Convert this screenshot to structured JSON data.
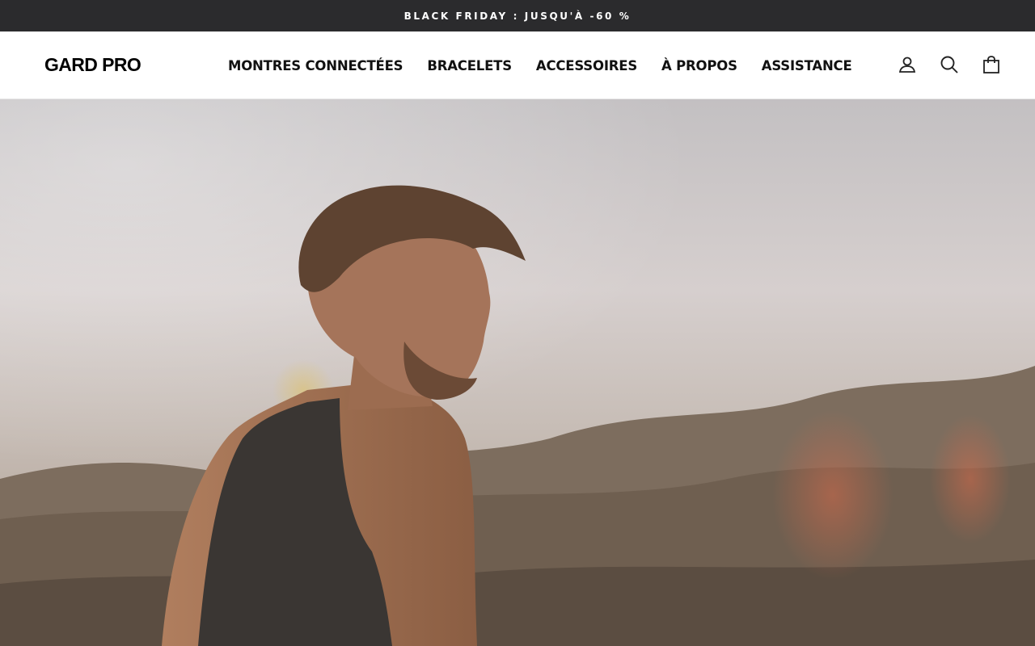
{
  "announcement": {
    "text": "BLACK FRIDAY : JUSQU'À -60 %"
  },
  "header": {
    "logo": "GARD PRO",
    "nav": [
      {
        "label": "MONTRES CONNECTÉES"
      },
      {
        "label": "BRACELETS"
      },
      {
        "label": "ACCESSOIRES"
      },
      {
        "label": "À PROPOS"
      },
      {
        "label": "ASSISTANCE"
      }
    ],
    "icons": [
      "user-icon",
      "search-icon",
      "cart-icon"
    ]
  },
  "hero": {
    "image": "man-in-tank-top-on-hill-at-sunset"
  },
  "colors": {
    "announcement_bg": "#2b2b2d",
    "announcement_text": "#ffffff",
    "header_bg": "#ffffff",
    "nav_text": "#111111"
  }
}
